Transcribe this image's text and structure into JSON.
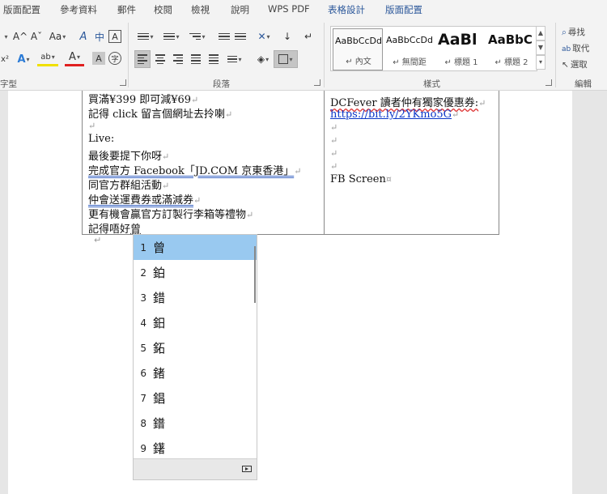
{
  "tabs": [
    "版面配置",
    "參考資料",
    "郵件",
    "校閱",
    "檢視",
    "說明",
    "WPS PDF",
    "表格設計",
    "版面配置"
  ],
  "ribbon": {
    "group_font": "字型",
    "group_paragraph": "段落",
    "group_styles": "樣式",
    "group_editing": "編輯",
    "font_buttons": {
      "grow": "A^",
      "shrink": "Aˇ",
      "case": "Aa",
      "clear": "A",
      "phonetic": "中",
      "border": "A",
      "x2": "x²",
      "effects": "A",
      "highlight": "ab",
      "color": "A",
      "shade": "A",
      "enclose": "字"
    },
    "styles": [
      {
        "sample": "AaBbCcDd",
        "name": "↵ 內文"
      },
      {
        "sample": "AaBbCcDd",
        "name": "↵ 無間距"
      },
      {
        "sample": "AaBl",
        "name": "↵ 標題 1"
      },
      {
        "sample": "AaBbC",
        "name": "↵ 標題 2"
      }
    ],
    "editing": [
      {
        "icon": "⌕",
        "label": "尋找"
      },
      {
        "icon": "ab",
        "label": "取代"
      },
      {
        "icon": "↖",
        "label": "選取"
      }
    ]
  },
  "document": {
    "left_cell": [
      "買滿¥399 即可減¥69",
      "記得 click 留言個網址去拎喇",
      "",
      "Live:",
      "最後要提下你呀",
      "完成官方 Facebook「JD.COM 京東香港」",
      "同官方群組活動",
      "仲會送運費券或滿減券",
      "更有機會贏官方訂製行李箱等禮物",
      "記得唔好"
    ],
    "composing": "曾",
    "right_cell": {
      "line1": "DCFever 讀者仲有獨家優惠券:",
      "link": "https://bit.ly/2YKmo5G",
      "fb": "FB Screen"
    },
    "paragraph_mark": "↵",
    "cell_mark": "¤"
  },
  "ime": {
    "candidates": [
      {
        "num": "1",
        "char": "曾"
      },
      {
        "num": "2",
        "char": "鉑"
      },
      {
        "num": "3",
        "char": "錯"
      },
      {
        "num": "4",
        "char": "鈤"
      },
      {
        "num": "5",
        "char": "鉐"
      },
      {
        "num": "6",
        "char": "鍺"
      },
      {
        "num": "7",
        "char": "錩"
      },
      {
        "num": "8",
        "char": "鐠"
      },
      {
        "num": "9",
        "char": "鐯"
      }
    ],
    "selected_index": 0
  }
}
